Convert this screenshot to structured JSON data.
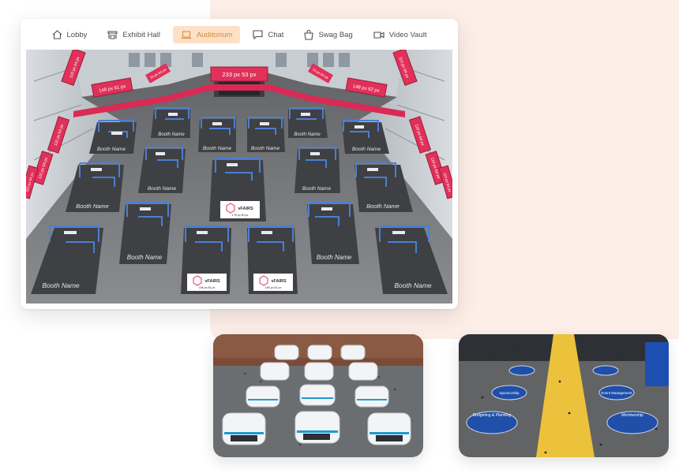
{
  "nav": {
    "items": [
      {
        "label": "Lobby",
        "icon": "home-icon",
        "active": false
      },
      {
        "label": "Exhibit Hall",
        "icon": "booth-icon",
        "active": false
      },
      {
        "label": "Auditorium",
        "icon": "laptop-icon",
        "active": true
      },
      {
        "label": "Chat",
        "icon": "chat-icon",
        "active": false
      },
      {
        "label": "Swag Bag",
        "icon": "bag-icon",
        "active": false
      },
      {
        "label": "Video Vault",
        "icon": "video-icon",
        "active": false
      }
    ]
  },
  "colors": {
    "accent": "#d58a3f",
    "active_bg": "#fde0c6",
    "banner": "#e0315a",
    "booth_outline": "#4a7fd4",
    "panel_bg": "#fdeee8",
    "carpet": "#ecc13b",
    "booth_blue": "#1f4fa8"
  },
  "hall": {
    "banners": {
      "center": "233 px 53 px",
      "left": "148 px 61 px",
      "right": "148 px 62 px",
      "upper_left": "70 px 64 px",
      "upper_right": "70 px 64 px",
      "left_wall": [
        "110 px 64 px",
        "110 px 64 px"
      ],
      "right_wall": [
        "110 px 64 px",
        "110 px 64 px"
      ]
    },
    "booth_label": "Booth Name",
    "logo_text": "vFAIRS",
    "logo_sizes": [
      "178 px 80 px",
      "166 px 81 px",
      "166 px 82 px"
    ]
  },
  "blue_hall": {
    "signs": [
      "Sponsorship",
      "Budgeting & Planning",
      "Event Management",
      "Membership"
    ]
  }
}
